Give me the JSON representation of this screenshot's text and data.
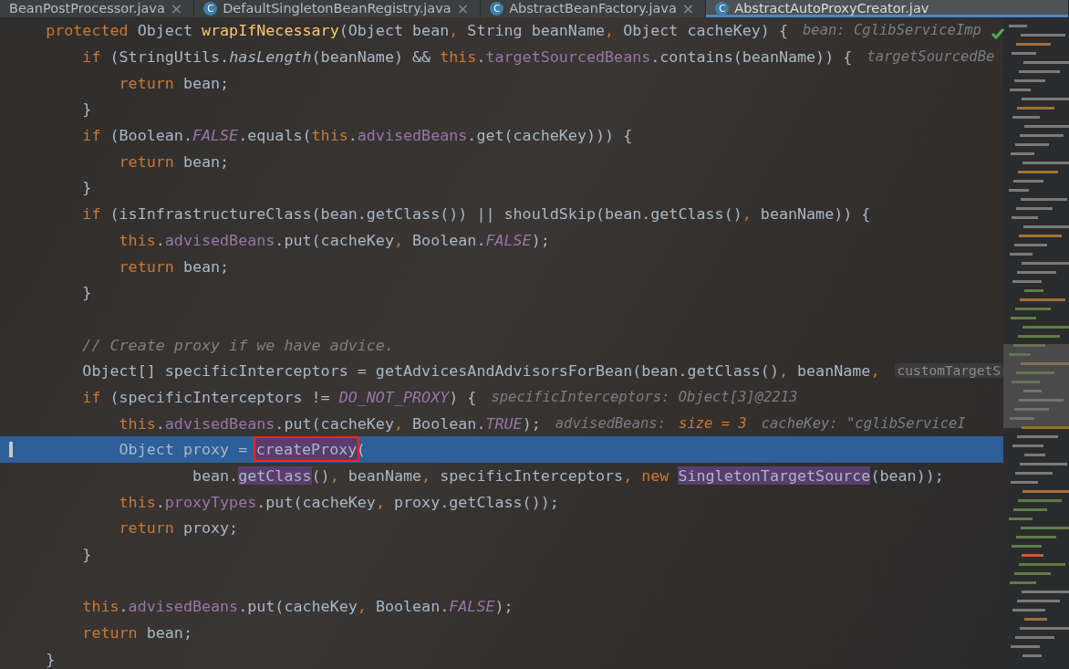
{
  "tabs": [
    {
      "label": "BeanPostProcessor.java",
      "selected": false,
      "close": "×"
    },
    {
      "label": "DefaultSingletonBeanRegistry.java",
      "selected": false,
      "icon": "C",
      "close": "×"
    },
    {
      "label": "AbstractBeanFactory.java",
      "selected": false,
      "icon": "C",
      "close": "×"
    },
    {
      "label": "AbstractAutoProxyCreator.jav",
      "selected": true,
      "icon": "C"
    }
  ],
  "lines": [
    {
      "selected": false,
      "tokens": [
        {
          "text": "    protected ",
          "kind": "kw"
        },
        {
          "text": "Object ",
          "kind": "plain"
        },
        {
          "text": "wrapIfNecessary",
          "kind": "method"
        },
        {
          "text": "(Object bean",
          "kind": "plain"
        },
        {
          "text": ", ",
          "kind": "kw"
        },
        {
          "text": "String beanName",
          "kind": "plain"
        },
        {
          "text": ", ",
          "kind": "kw"
        },
        {
          "text": "Object cacheKey) {",
          "kind": "plain"
        }
      ],
      "hints": [
        {
          "text": "bean: CglibServiceImp",
          "kind": "debug"
        }
      ]
    },
    {
      "selected": false,
      "tokens": [
        {
          "text": "        if ",
          "kind": "kw"
        },
        {
          "text": "(StringUtils.",
          "kind": "plain"
        },
        {
          "text": "hasLength",
          "kind": "italic"
        },
        {
          "text": "(beanName) && ",
          "kind": "plain"
        },
        {
          "text": "this",
          "kind": "kw"
        },
        {
          "text": ".",
          "kind": "plain"
        },
        {
          "text": "targetSourcedBeans",
          "kind": "field"
        },
        {
          "text": ".contains(beanName)) {",
          "kind": "plain"
        }
      ],
      "hints": [
        {
          "text": "targetSourcedBe",
          "kind": "debug"
        }
      ]
    },
    {
      "selected": false,
      "tokens": [
        {
          "text": "            return ",
          "kind": "kw"
        },
        {
          "text": "bean;",
          "kind": "plain"
        }
      ]
    },
    {
      "selected": false,
      "tokens": [
        {
          "text": "        }",
          "kind": "plain"
        }
      ]
    },
    {
      "selected": false,
      "tokens": [
        {
          "text": "        if ",
          "kind": "kw"
        },
        {
          "text": "(Boolean.",
          "kind": "plain"
        },
        {
          "text": "FALSE",
          "kind": "static"
        },
        {
          "text": ".equals(",
          "kind": "plain"
        },
        {
          "text": "this",
          "kind": "kw"
        },
        {
          "text": ".",
          "kind": "plain"
        },
        {
          "text": "advisedBeans",
          "kind": "field"
        },
        {
          "text": ".get(cacheKey))) {",
          "kind": "plain"
        }
      ]
    },
    {
      "selected": false,
      "tokens": [
        {
          "text": "            return ",
          "kind": "kw"
        },
        {
          "text": "bean;",
          "kind": "plain"
        }
      ]
    },
    {
      "selected": false,
      "tokens": [
        {
          "text": "        }",
          "kind": "plain"
        }
      ]
    },
    {
      "selected": false,
      "tokens": [
        {
          "text": "        if ",
          "kind": "kw"
        },
        {
          "text": "(isInfrastructureClass(bean.getClass()) || shouldSkip(bean.getClass()",
          "kind": "plain"
        },
        {
          "text": ", ",
          "kind": "kw"
        },
        {
          "text": "beanName)) {",
          "kind": "plain"
        }
      ]
    },
    {
      "selected": false,
      "tokens": [
        {
          "text": "            this",
          "kind": "kw"
        },
        {
          "text": ".",
          "kind": "plain"
        },
        {
          "text": "advisedBeans",
          "kind": "field"
        },
        {
          "text": ".put(cacheKey",
          "kind": "plain"
        },
        {
          "text": ", ",
          "kind": "kw"
        },
        {
          "text": "Boolean.",
          "kind": "plain"
        },
        {
          "text": "FALSE",
          "kind": "static"
        },
        {
          "text": ");",
          "kind": "plain"
        }
      ]
    },
    {
      "selected": false,
      "tokens": [
        {
          "text": "            return ",
          "kind": "kw"
        },
        {
          "text": "bean;",
          "kind": "plain"
        }
      ]
    },
    {
      "selected": false,
      "tokens": [
        {
          "text": "        }",
          "kind": "plain"
        }
      ]
    },
    {
      "selected": false
    },
    {
      "selected": false,
      "tokens": [
        {
          "text": "        // Create proxy if we have advice.",
          "kind": "comment"
        }
      ]
    },
    {
      "selected": false,
      "tokens": [
        {
          "text": "        Object[] specificInterceptors = getAdvicesAndAdvisorsForBean(bean.getClass()",
          "kind": "plain"
        },
        {
          "text": ", ",
          "kind": "kw"
        },
        {
          "text": "beanName",
          "kind": "plain"
        },
        {
          "text": ", ",
          "kind": "kw"
        }
      ],
      "hints": [
        {
          "text": "customTargetS",
          "kind": "param"
        }
      ]
    },
    {
      "selected": false,
      "tokens": [
        {
          "text": "        if ",
          "kind": "kw"
        },
        {
          "text": "(specificInterceptors != ",
          "kind": "plain"
        },
        {
          "text": "DO_NOT_PROXY",
          "kind": "static"
        },
        {
          "text": ") {",
          "kind": "plain"
        }
      ],
      "hints": [
        {
          "text": "specificInterceptors: Object[3]@2213",
          "kind": "debug"
        }
      ]
    },
    {
      "selected": false,
      "tokens": [
        {
          "text": "            this",
          "kind": "kw"
        },
        {
          "text": ".",
          "kind": "plain"
        },
        {
          "text": "advisedBeans",
          "kind": "field"
        },
        {
          "text": ".put(cacheKey",
          "kind": "plain"
        },
        {
          "text": ", ",
          "kind": "kw"
        },
        {
          "text": "Boolean.",
          "kind": "plain"
        },
        {
          "text": "TRUE",
          "kind": "static"
        },
        {
          "text": ");",
          "kind": "plain"
        }
      ],
      "hints": [
        {
          "text": "advisedBeans:",
          "kind": "debug"
        },
        {
          "text": "size = 3",
          "kind": "value"
        },
        {
          "text": "cacheKey: \"cglibServiceI",
          "kind": "debug"
        }
      ]
    },
    {
      "selected": true,
      "tokens": [
        {
          "text": "            Object proxy = ",
          "kind": "plain"
        },
        {
          "text": "createProxy",
          "kind": "plain",
          "usage": true,
          "boxed": true
        },
        {
          "text": "(",
          "kind": "plain"
        }
      ]
    },
    {
      "selected": false,
      "tokens": [
        {
          "text": "                    bean.",
          "kind": "plain"
        },
        {
          "text": "getClass",
          "kind": "plain",
          "usage": true
        },
        {
          "text": "()",
          "kind": "plain"
        },
        {
          "text": ", ",
          "kind": "kw"
        },
        {
          "text": "beanName",
          "kind": "plain"
        },
        {
          "text": ", ",
          "kind": "kw"
        },
        {
          "text": "specificInterceptors",
          "kind": "plain"
        },
        {
          "text": ", ",
          "kind": "kw"
        },
        {
          "text": "new ",
          "kind": "kw"
        },
        {
          "text": "SingletonTargetSource",
          "kind": "plain",
          "usage": true
        },
        {
          "text": "(bean));",
          "kind": "plain"
        }
      ]
    },
    {
      "selected": false,
      "tokens": [
        {
          "text": "            this",
          "kind": "kw"
        },
        {
          "text": ".",
          "kind": "plain"
        },
        {
          "text": "proxyTypes",
          "kind": "field"
        },
        {
          "text": ".put(cacheKey",
          "kind": "plain"
        },
        {
          "text": ", ",
          "kind": "kw"
        },
        {
          "text": "proxy.getClass());",
          "kind": "plain"
        }
      ]
    },
    {
      "selected": false,
      "tokens": [
        {
          "text": "            return ",
          "kind": "kw"
        },
        {
          "text": "proxy;",
          "kind": "plain"
        }
      ]
    },
    {
      "selected": false,
      "tokens": [
        {
          "text": "        }",
          "kind": "plain"
        }
      ]
    },
    {
      "selected": false
    },
    {
      "selected": false,
      "tokens": [
        {
          "text": "        this",
          "kind": "kw"
        },
        {
          "text": ".",
          "kind": "plain"
        },
        {
          "text": "advisedBeans",
          "kind": "field"
        },
        {
          "text": ".put(cacheKey",
          "kind": "plain"
        },
        {
          "text": ", ",
          "kind": "kw"
        },
        {
          "text": "Boolean.",
          "kind": "plain"
        },
        {
          "text": "FALSE",
          "kind": "static"
        },
        {
          "text": ");",
          "kind": "plain"
        }
      ]
    },
    {
      "selected": false,
      "tokens": [
        {
          "text": "        return ",
          "kind": "kw"
        },
        {
          "text": "bean;",
          "kind": "plain"
        }
      ]
    },
    {
      "selected": false,
      "tokens": [
        {
          "text": "    }",
          "kind": "plain"
        }
      ]
    }
  ]
}
